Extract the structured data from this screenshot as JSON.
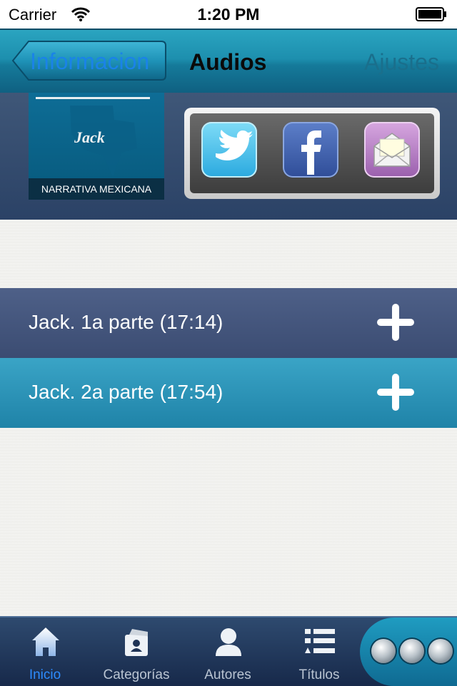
{
  "status_bar": {
    "carrier": "Carrier",
    "time": "1:20 PM"
  },
  "nav": {
    "back_label": "Informacion",
    "current_tab": "Audios",
    "settings_tab": "Ajustes"
  },
  "cover": {
    "title": "Jack",
    "footer": "NARRATIVA MEXICANA"
  },
  "share": {
    "buttons": [
      "twitter-icon",
      "facebook-icon",
      "mail-icon"
    ]
  },
  "tracks": [
    {
      "title": "Jack. 1a parte (17:14)"
    },
    {
      "title": "Jack. 2a parte (17:54)"
    }
  ],
  "tabbar": {
    "items": [
      {
        "label": "Inicio",
        "icon": "home-icon",
        "active": true
      },
      {
        "label": "Categorías",
        "icon": "categories-icon",
        "active": false
      },
      {
        "label": "Autores",
        "icon": "author-icon",
        "active": false
      },
      {
        "label": "Títulos",
        "icon": "list-icon",
        "active": false
      }
    ],
    "more_icon": "more-icon"
  },
  "colors": {
    "accent": "#2d8cff",
    "nav_teal": "#1d8fae",
    "row_dark": "#4e6088",
    "row_light": "#3aa4c6"
  }
}
